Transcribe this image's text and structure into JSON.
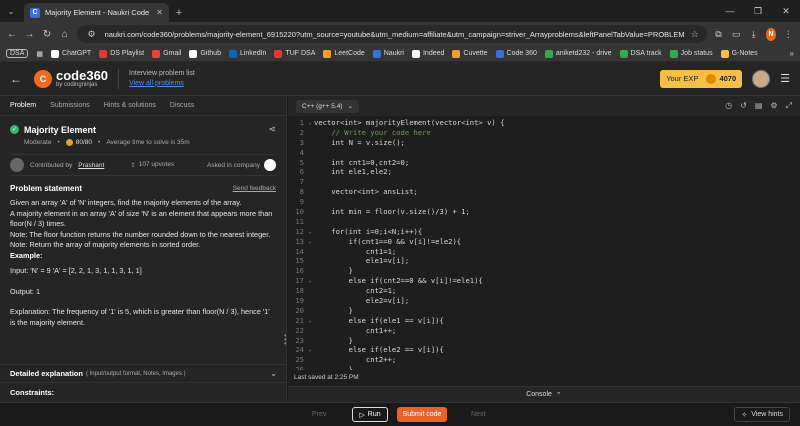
{
  "browser": {
    "tab_title": "Majority Element - Naukri Code",
    "tab_favicon": "C",
    "url": "naukri.com/code360/problems/majority-element_6915220?utm_source=youtube&utm_medium=affiliate&utm_campaign=striver_Arrayproblems&leftPanelTabValue=PROBLEM",
    "profile_letter": "N",
    "bookmarks": [
      {
        "label": "ChatGPT",
        "color": "#ffffff"
      },
      {
        "label": "DS Playlist",
        "color": "#e53935"
      },
      {
        "label": "Gmail",
        "color": "#ea4335"
      },
      {
        "label": "Github",
        "color": "#ffffff"
      },
      {
        "label": "LinkedIn",
        "color": "#0a66c2"
      },
      {
        "label": "TUF DSA",
        "color": "#e53935"
      },
      {
        "label": "LeetCode",
        "color": "#f89f1b"
      },
      {
        "label": "Naukri",
        "color": "#3a6fe0"
      },
      {
        "label": "Indeed",
        "color": "#ffffff"
      },
      {
        "label": "Cuvette",
        "color": "#f0a030"
      },
      {
        "label": "Code 360",
        "color": "#3a6fe0"
      },
      {
        "label": "aniketd232 - drive",
        "color": "#34a853"
      },
      {
        "label": "DSA track",
        "color": "#34a853"
      },
      {
        "label": "Job status",
        "color": "#34a853"
      },
      {
        "label": "G-Notes",
        "color": "#f6c044"
      }
    ],
    "dsa_label": "DSA"
  },
  "header": {
    "logo_big": "code360",
    "logo_small": "by codingninjas",
    "plist_label": "Interview problem list",
    "plist_link": "View all problems",
    "exp_label": "Your EXP",
    "exp_points": "4070"
  },
  "left": {
    "tabs": [
      "Problem",
      "Submissions",
      "Hints & solutions",
      "Discuss"
    ],
    "title": "Majority Element",
    "difficulty": "Moderate",
    "score": "80/80",
    "avg_time": "Average time to solve is 35m",
    "contributed_by": "Contributed by",
    "contributor": "Prashant",
    "upvotes": "107 upvotes",
    "asked_in": "Asked in company",
    "statement_heading": "Problem statement",
    "feedback": "Send feedback",
    "lines": [
      "Given an array 'A' of 'N' integers, find the majority elements of the array.",
      "A majority element in an array 'A' of size 'N' is an element that appears more than floor(N / 3) times.",
      "Note: The floor function returns the number rounded down to the nearest integer.",
      "Note: Return the array of majority elements in sorted order."
    ],
    "example_label": "Example:",
    "input": "Input: 'N' = 9 'A' = [2, 2, 1, 3, 1, 1, 3, 1, 1]",
    "output": "Output: 1",
    "explanation": "Explanation: The frequency of '1' is 5, which is greater than floor(N / 3), hence '1' is the majority element.",
    "detailed": "Detailed explanation",
    "detailed_sub": "( Input/output format, Notes, Images )",
    "constraints": "Constraints:"
  },
  "editor": {
    "language": "C++ (g++ 5.4)",
    "last_saved": "Last saved at 2:25 PM",
    "console": "Console",
    "lines": [
      {
        "n": "1",
        "text": "vector<int> majorityElement(vector<int> v) {",
        "fold": "⌄"
      },
      {
        "n": "2",
        "text": "    // Write your code here",
        "fold": ""
      },
      {
        "n": "3",
        "text": "    int N = v.size();",
        "fold": ""
      },
      {
        "n": "4",
        "text": "",
        "fold": ""
      },
      {
        "n": "5",
        "text": "    int cnt1=0,cnt2=0;",
        "fold": ""
      },
      {
        "n": "6",
        "text": "    int ele1,ele2;",
        "fold": ""
      },
      {
        "n": "7",
        "text": "",
        "fold": ""
      },
      {
        "n": "8",
        "text": "    vector<int> ansList;",
        "fold": ""
      },
      {
        "n": "9",
        "text": "",
        "fold": ""
      },
      {
        "n": "10",
        "text": "    int min = floor(v.size()/3) + 1;",
        "fold": ""
      },
      {
        "n": "11",
        "text": "",
        "fold": ""
      },
      {
        "n": "12",
        "text": "    for(int i=0;i<N;i++){",
        "fold": "⌄"
      },
      {
        "n": "13",
        "text": "        if(cnt1==0 && v[i]!=ele2){",
        "fold": "⌄"
      },
      {
        "n": "14",
        "text": "            cnt1=1;",
        "fold": ""
      },
      {
        "n": "15",
        "text": "            ele1=v[i];",
        "fold": ""
      },
      {
        "n": "16",
        "text": "        }",
        "fold": ""
      },
      {
        "n": "17",
        "text": "        else if(cnt2==0 && v[i]!=ele1){",
        "fold": "⌄"
      },
      {
        "n": "18",
        "text": "            cnt2=1;",
        "fold": ""
      },
      {
        "n": "19",
        "text": "            ele2=v[i];",
        "fold": ""
      },
      {
        "n": "20",
        "text": "        }",
        "fold": ""
      },
      {
        "n": "21",
        "text": "        else if(ele1 == v[i]){",
        "fold": "⌄"
      },
      {
        "n": "22",
        "text": "            cnt1++;",
        "fold": ""
      },
      {
        "n": "23",
        "text": "        }",
        "fold": ""
      },
      {
        "n": "24",
        "text": "        else if(ele2 == v[i]){",
        "fold": "⌄"
      },
      {
        "n": "25",
        "text": "            cnt2++;",
        "fold": ""
      },
      {
        "n": "26",
        "text": "        }",
        "fold": ""
      }
    ]
  },
  "bottom": {
    "prev": "Prev",
    "run": "Run",
    "submit": "Submit code",
    "next": "Next",
    "hints": "View hints"
  },
  "colors": {
    "accent": "#e8632a",
    "exp_bg": "#f6c044",
    "link": "#4c8dff",
    "code_keyword": "#569cd6",
    "code_comment": "#6a9955",
    "code_number": "#b5cea8"
  }
}
